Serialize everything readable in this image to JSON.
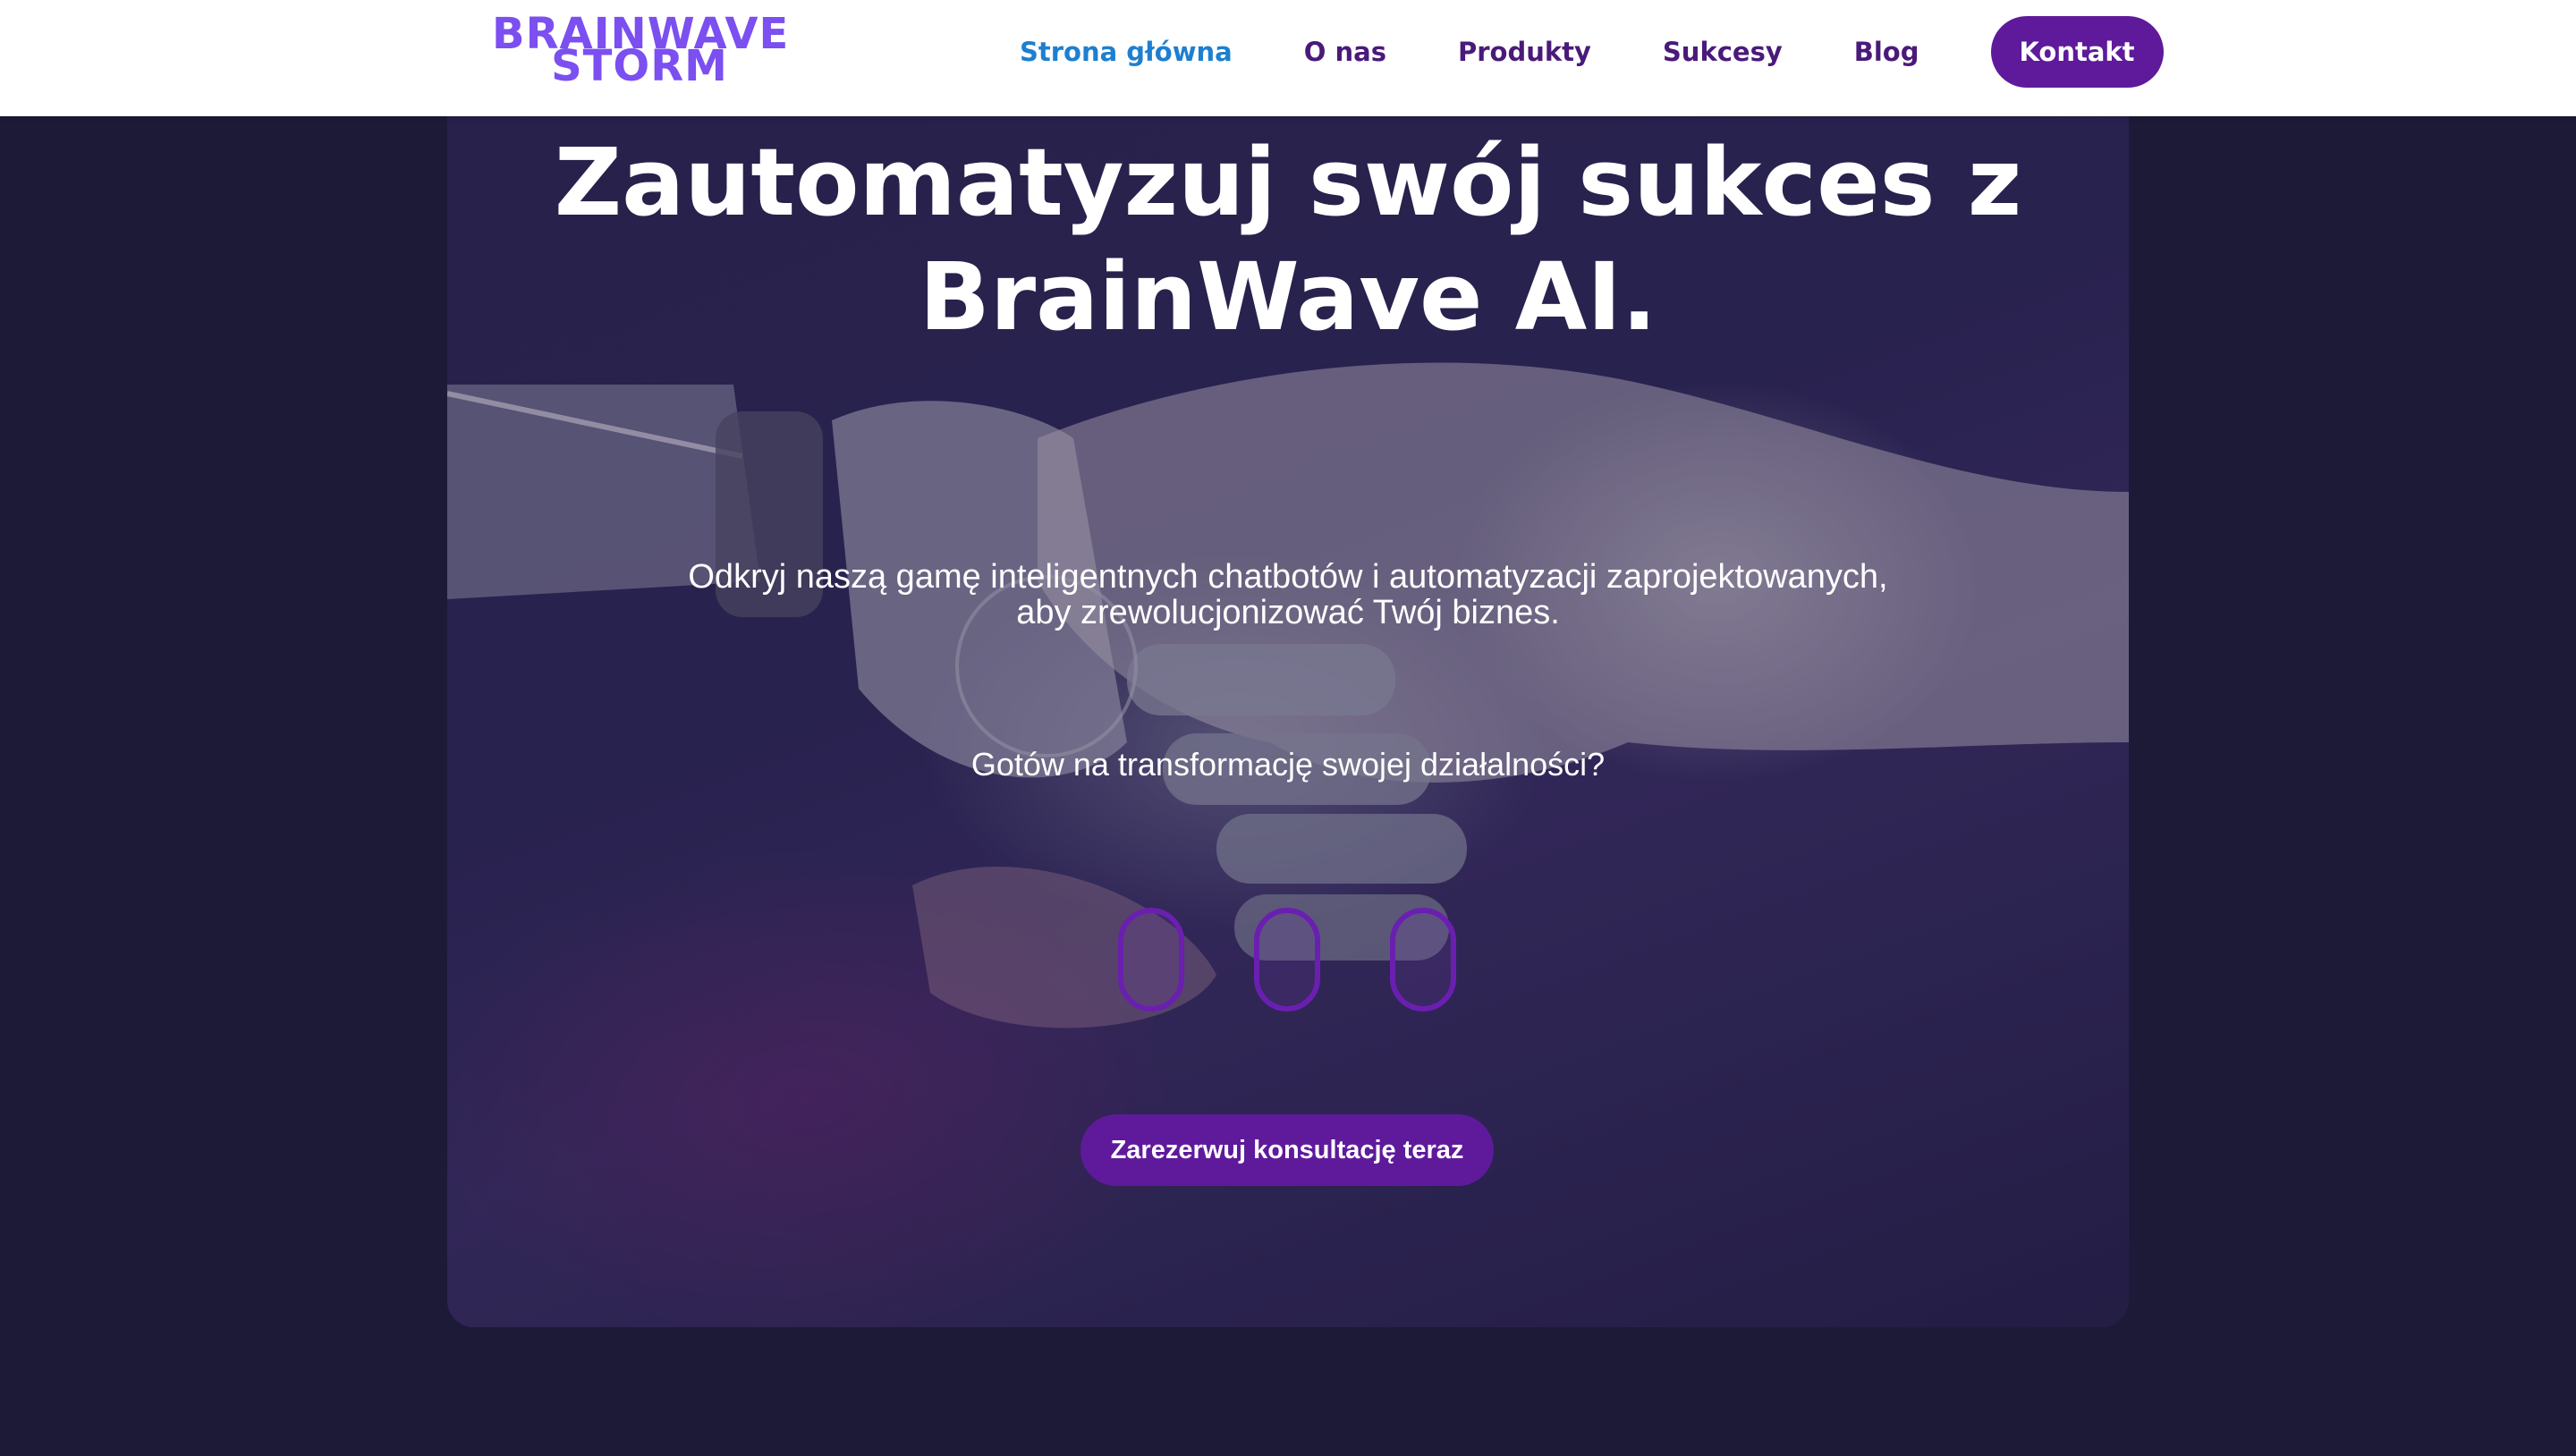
{
  "header": {
    "logo_line1": "BRAINWAVE",
    "logo_line2": "STORM",
    "nav": [
      {
        "label": "Strona główna"
      },
      {
        "label": "O nas"
      },
      {
        "label": "Produkty"
      },
      {
        "label": "Sukcesy"
      },
      {
        "label": "Blog"
      }
    ],
    "cta_label": "Kontakt"
  },
  "hero": {
    "title_line1": "Zautomatyzuj swój sukces z",
    "title_line2": "BrainWave AI.",
    "subtitle_line1": "Odkryj naszą gamę inteligentnych chatbotów i automatyzacji zaprojektowanych,",
    "subtitle_line2": "aby zrewolucjonizować Twój biznes.",
    "question": "Gotów na transformację swojej działalności?",
    "button_label": "Zarezerwuj konsultację teraz",
    "background_image": "robot-and-human-handshake"
  },
  "colors": {
    "brand_purple": "#5f1a9b",
    "logo_purple": "#7b4ff0",
    "nav_active": "#1e7fd0",
    "nav_text": "#4a1a7a",
    "page_bg": "#1d1a38"
  }
}
